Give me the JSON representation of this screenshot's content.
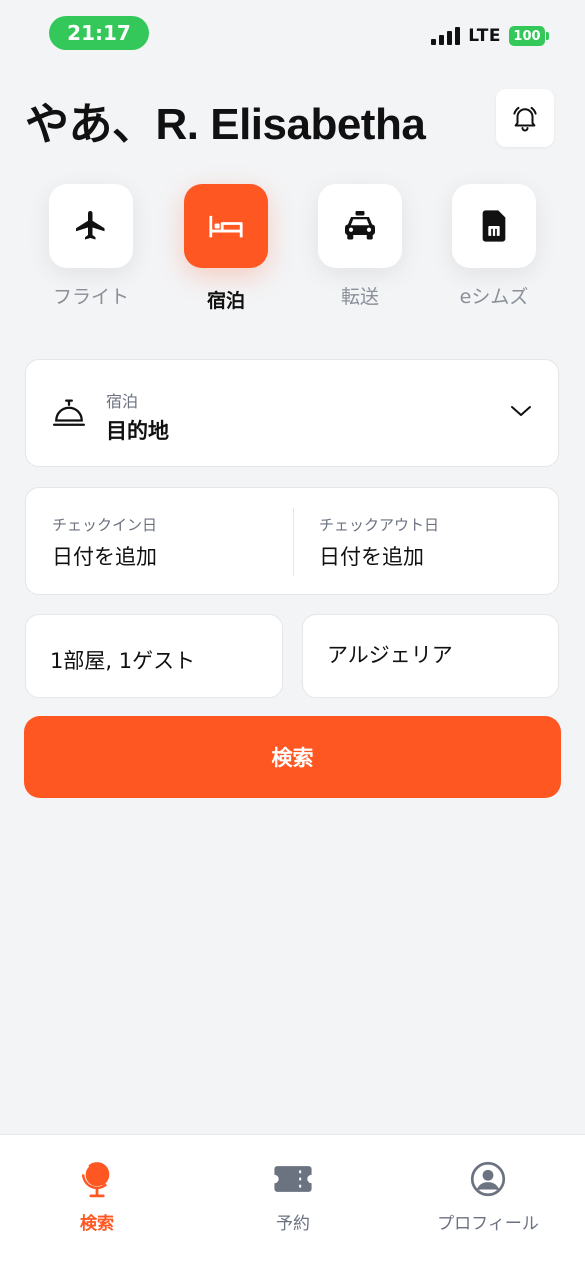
{
  "status_bar": {
    "time": "21:17",
    "network": "LTE",
    "battery": "100",
    "pill_color": "#34c759"
  },
  "header": {
    "greeting": "やあ、R. Elisabetha",
    "bell_icon": "bell-icon"
  },
  "categories": [
    {
      "label": "フライト",
      "icon": "airplane-icon",
      "active": false
    },
    {
      "label": "宿泊",
      "icon": "bed-icon",
      "active": true
    },
    {
      "label": "転送",
      "icon": "taxi-icon",
      "active": false
    },
    {
      "label": "eシムズ",
      "icon": "sim-card-icon",
      "active": false
    }
  ],
  "destination": {
    "small_label": "宿泊",
    "value": "目的地",
    "icon": "service-bell-icon"
  },
  "dates": {
    "checkin_label": "チェックイン日",
    "checkin_value": "日付を追加",
    "checkout_label": "チェックアウト日",
    "checkout_value": "日付を追加"
  },
  "guests": {
    "value": "1部屋, 1ゲスト"
  },
  "country": {
    "value": "アルジェリア"
  },
  "search_button": {
    "label": "検索"
  },
  "bottom_nav": [
    {
      "label": "検索",
      "icon": "globe-icon",
      "active": true
    },
    {
      "label": "予約",
      "icon": "ticket-icon",
      "active": false
    },
    {
      "label": "プロフィール",
      "icon": "user-icon",
      "active": false
    }
  ],
  "colors": {
    "accent": "#ff5722",
    "background": "#f3f4f6"
  }
}
